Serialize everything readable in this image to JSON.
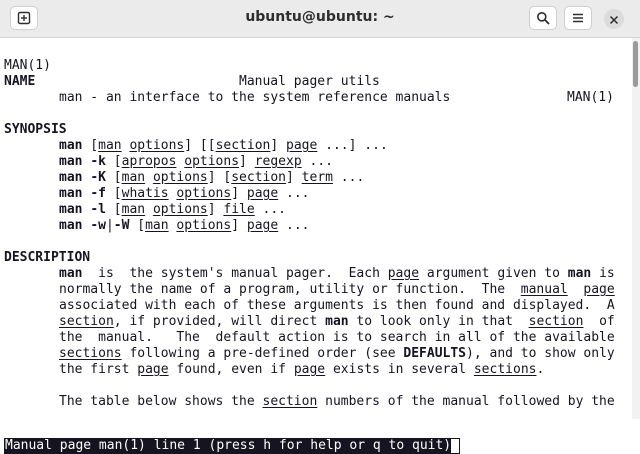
{
  "window": {
    "title": "ubuntu@ubuntu: ~"
  },
  "header": {
    "left": "MAN(1)",
    "center": "Manual pager utils",
    "right": "MAN(1)"
  },
  "sections": {
    "name": {
      "heading": "NAME",
      "text": "man - an interface to the system reference manuals"
    },
    "synopsis": {
      "heading": "SYNOPSIS",
      "lines": [
        [
          {
            "t": "man",
            "s": "b"
          },
          {
            "t": " ["
          },
          {
            "t": "man",
            "s": "u"
          },
          {
            "t": " "
          },
          {
            "t": "options",
            "s": "u"
          },
          {
            "t": "] [["
          },
          {
            "t": "section",
            "s": "u"
          },
          {
            "t": "] "
          },
          {
            "t": "page",
            "s": "u"
          },
          {
            "t": " ...] ..."
          }
        ],
        [
          {
            "t": "man",
            "s": "b"
          },
          {
            "t": " "
          },
          {
            "t": "-k",
            "s": "b"
          },
          {
            "t": " ["
          },
          {
            "t": "apropos",
            "s": "u"
          },
          {
            "t": " "
          },
          {
            "t": "options",
            "s": "u"
          },
          {
            "t": "] "
          },
          {
            "t": "regexp",
            "s": "u"
          },
          {
            "t": " ..."
          }
        ],
        [
          {
            "t": "man",
            "s": "b"
          },
          {
            "t": " "
          },
          {
            "t": "-K",
            "s": "b"
          },
          {
            "t": " ["
          },
          {
            "t": "man",
            "s": "u"
          },
          {
            "t": " "
          },
          {
            "t": "options",
            "s": "u"
          },
          {
            "t": "] ["
          },
          {
            "t": "section",
            "s": "u"
          },
          {
            "t": "] "
          },
          {
            "t": "term",
            "s": "u"
          },
          {
            "t": " ..."
          }
        ],
        [
          {
            "t": "man",
            "s": "b"
          },
          {
            "t": " "
          },
          {
            "t": "-f",
            "s": "b"
          },
          {
            "t": " ["
          },
          {
            "t": "whatis",
            "s": "u"
          },
          {
            "t": " "
          },
          {
            "t": "options",
            "s": "u"
          },
          {
            "t": "] "
          },
          {
            "t": "page",
            "s": "u"
          },
          {
            "t": " ..."
          }
        ],
        [
          {
            "t": "man",
            "s": "b"
          },
          {
            "t": " "
          },
          {
            "t": "-l",
            "s": "b"
          },
          {
            "t": " ["
          },
          {
            "t": "man",
            "s": "u"
          },
          {
            "t": " "
          },
          {
            "t": "options",
            "s": "u"
          },
          {
            "t": "] "
          },
          {
            "t": "file",
            "s": "u"
          },
          {
            "t": " ..."
          }
        ],
        [
          {
            "t": "man",
            "s": "b"
          },
          {
            "t": " "
          },
          {
            "t": "-w",
            "s": "b"
          },
          {
            "t": "|"
          },
          {
            "t": "-W",
            "s": "b"
          },
          {
            "t": " ["
          },
          {
            "t": "man",
            "s": "u"
          },
          {
            "t": " "
          },
          {
            "t": "options",
            "s": "u"
          },
          {
            "t": "] "
          },
          {
            "t": "page",
            "s": "u"
          },
          {
            "t": " ..."
          }
        ]
      ]
    },
    "description": {
      "heading": "DESCRIPTION",
      "lines": [
        [
          {
            "t": "man",
            "s": "b"
          },
          {
            "t": "  is  the system's manual pager.  Each "
          },
          {
            "t": "page",
            "s": "u"
          },
          {
            "t": " argument given to "
          },
          {
            "t": "man",
            "s": "b"
          },
          {
            "t": " is"
          }
        ],
        [
          {
            "t": "normally the name of a program, utility or function.  The  "
          },
          {
            "t": "manual",
            "s": "u"
          },
          {
            "t": "  "
          },
          {
            "t": "page",
            "s": "u"
          }
        ],
        [
          {
            "t": "associated with each of these arguments is then found and displayed.  A"
          }
        ],
        [
          {
            "t": "section",
            "s": "u"
          },
          {
            "t": ", if provided, will direct "
          },
          {
            "t": "man",
            "s": "b"
          },
          {
            "t": " to look only in that  "
          },
          {
            "t": "section",
            "s": "u"
          },
          {
            "t": "  of"
          }
        ],
        [
          {
            "t": "the  manual.   The  default action is to search in all of the available"
          }
        ],
        [
          {
            "t": "sections",
            "s": "u"
          },
          {
            "t": " following a pre-defined order (see "
          },
          {
            "t": "DEFAULTS",
            "s": "b"
          },
          {
            "t": "), and to show only"
          }
        ],
        [
          {
            "t": "the first "
          },
          {
            "t": "page",
            "s": "u"
          },
          {
            "t": " found, even if "
          },
          {
            "t": "page",
            "s": "u"
          },
          {
            "t": " exists in several "
          },
          {
            "t": "sections",
            "s": "u"
          },
          {
            "t": "."
          }
        ],
        [],
        [
          {
            "t": "The table below shows the "
          },
          {
            "t": "section",
            "s": "u"
          },
          {
            "t": " numbers of the manual followed by the"
          }
        ]
      ]
    }
  },
  "status_bar": {
    "text": "Manual page man(1) line 1 (press h for help or q to quit)"
  },
  "toolbar": {
    "new_tab_icon": "new-tab-icon",
    "search_icon": "search-icon",
    "menu_icon": "hamburger-menu-icon",
    "close_icon": "close-icon"
  }
}
